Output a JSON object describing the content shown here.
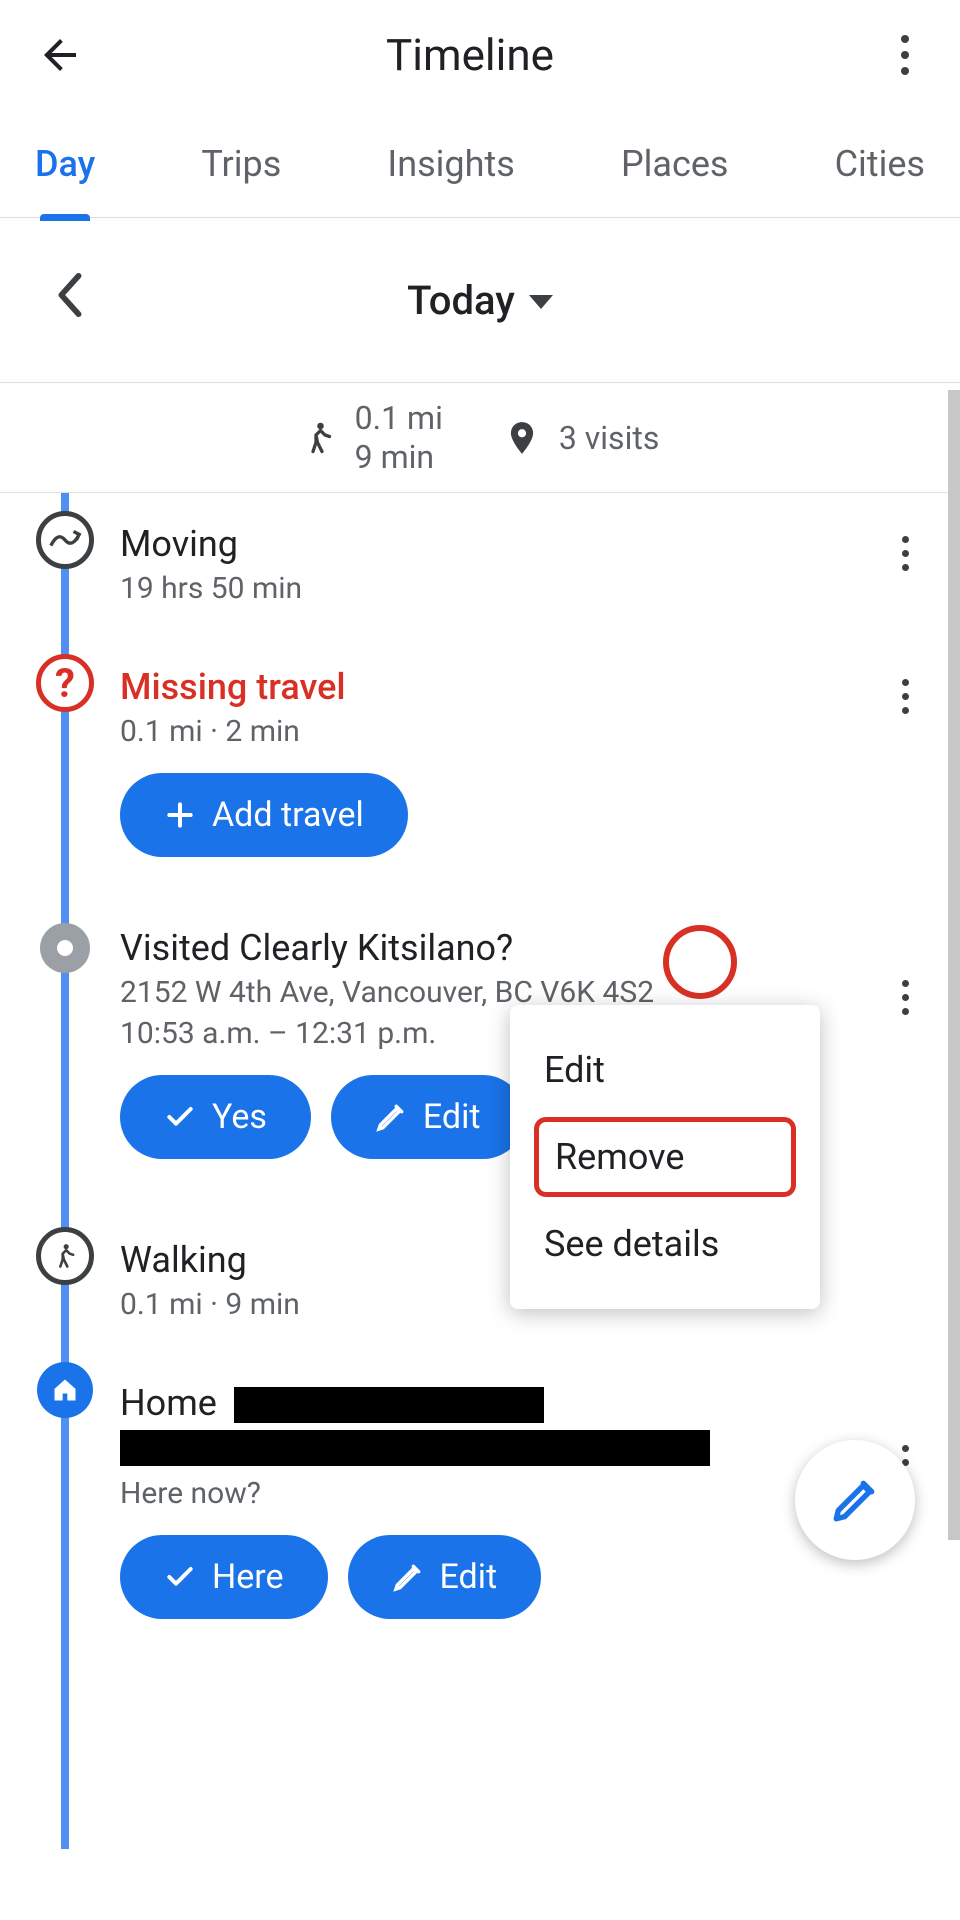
{
  "header": {
    "title": "Timeline"
  },
  "tabs": {
    "items": [
      {
        "label": "Day"
      },
      {
        "label": "Trips"
      },
      {
        "label": "Insights"
      },
      {
        "label": "Places"
      },
      {
        "label": "Cities"
      }
    ]
  },
  "dateNav": {
    "current": "Today"
  },
  "summary": {
    "distance": "0.1 mi",
    "duration": "9 min",
    "visits": "3 visits"
  },
  "items": {
    "moving": {
      "title": "Moving",
      "sub": "19 hrs 50 min"
    },
    "missing": {
      "title": "Missing travel",
      "sub": "0.1 mi · 2 min",
      "button": "Add travel"
    },
    "visited": {
      "title": "Visited Clearly Kitsilano?",
      "address": "2152 W 4th Ave, Vancouver, BC V6K 4S2",
      "time": "10:53 a.m. – 12:31 p.m.",
      "yes": "Yes",
      "edit": "Edit"
    },
    "walking": {
      "title": "Walking",
      "sub": "0.1 mi · 9 min"
    },
    "home": {
      "title": "Home",
      "hereNow": "Here now?",
      "here": "Here",
      "edit": "Edit"
    }
  },
  "popup": {
    "edit": "Edit",
    "remove": "Remove",
    "details": "See details"
  }
}
